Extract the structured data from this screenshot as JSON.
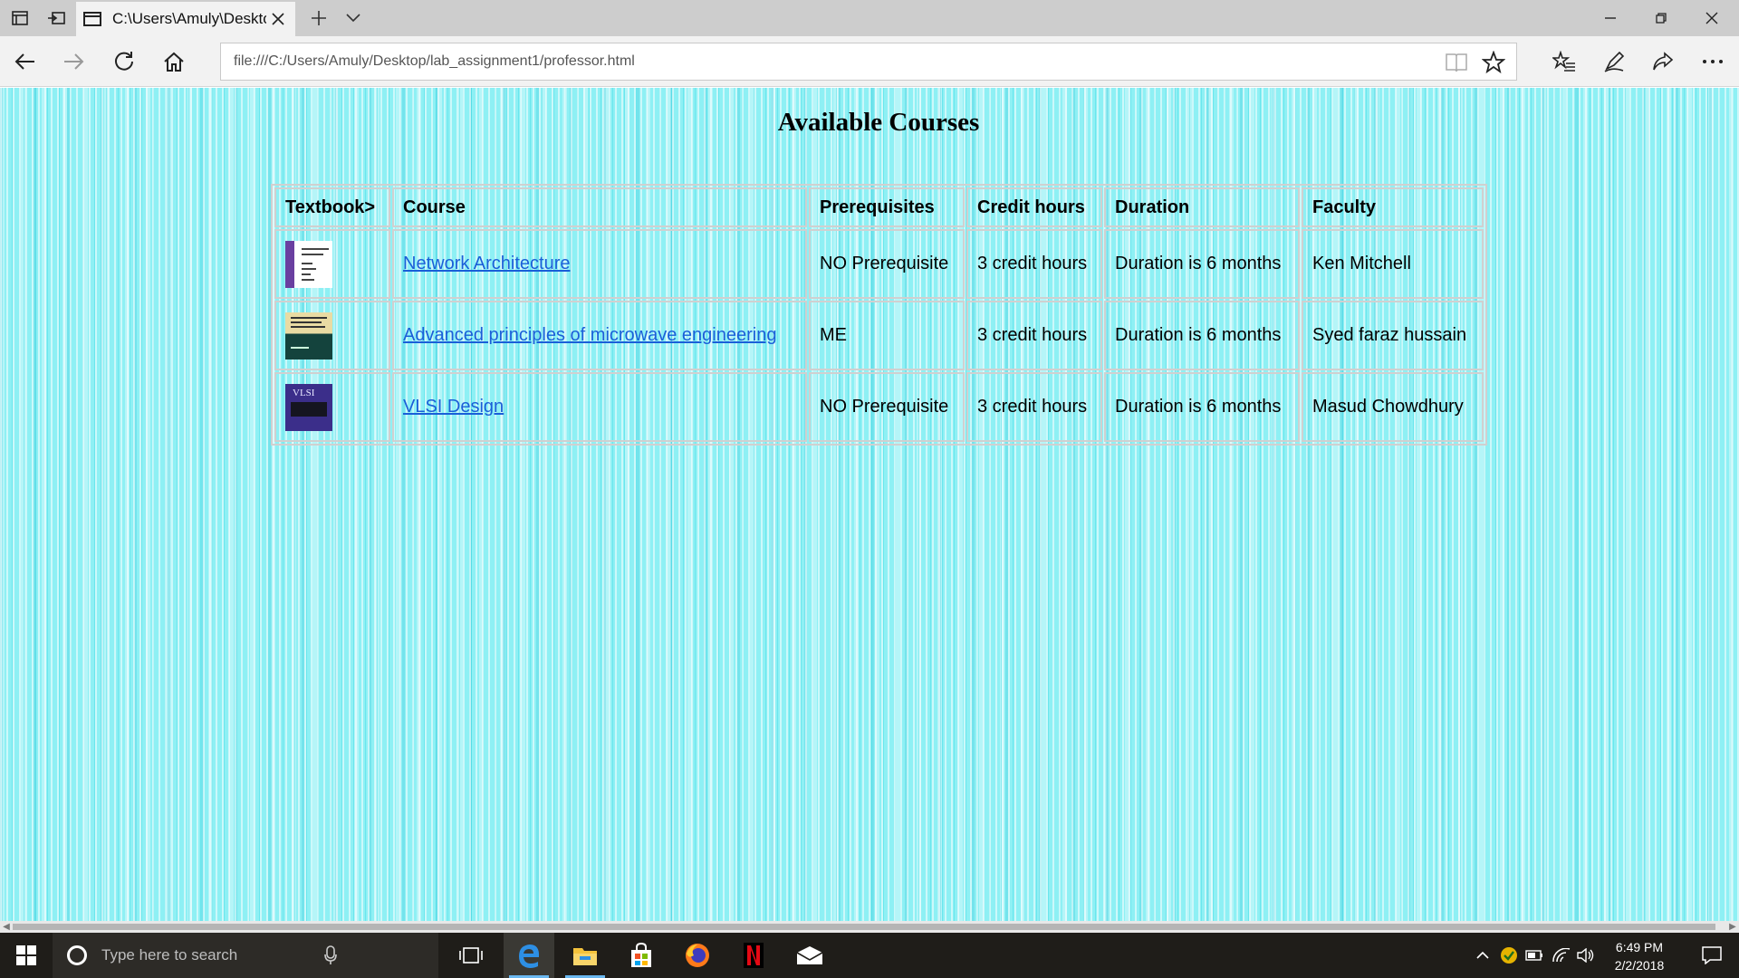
{
  "browser": {
    "tab_title": "C:\\Users\\Amuly\\Deskto",
    "address_url": "file:///C:/Users/Amuly/Desktop/lab_assignment1/professor.html",
    "accent_color": "#1a5fd8"
  },
  "page": {
    "title": "Available Courses",
    "background_color": "#8ef0f4",
    "headers": [
      "Textbook>",
      "Course",
      "Prerequisites",
      "Credit hours",
      "Duration",
      "Faculty"
    ],
    "rows": [
      {
        "textbook_icon": "book-cover-network-architecture",
        "course": "Network Architecture",
        "prerequisites": "NO Prerequisite",
        "credit_hours": "3 credit hours",
        "duration": "Duration is 6 months",
        "faculty": "Ken Mitchell"
      },
      {
        "textbook_icon": "book-cover-microwave-engineering",
        "course": "Advanced principles of microwave engineering",
        "prerequisites": "ME",
        "credit_hours": "3 credit hours",
        "duration": "Duration is 6 months",
        "faculty": "Syed faraz hussain"
      },
      {
        "textbook_icon": "book-cover-vlsi-design",
        "course": "VLSI Design",
        "prerequisites": "NO Prerequisite",
        "credit_hours": "3 credit hours",
        "duration": "Duration is 6 months",
        "faculty": "Masud Chowdhury",
        "cover_text": "VLSI"
      }
    ]
  },
  "taskbar": {
    "search_placeholder": "Type here to search",
    "time": "6:49 PM",
    "date": "2/2/2018"
  }
}
